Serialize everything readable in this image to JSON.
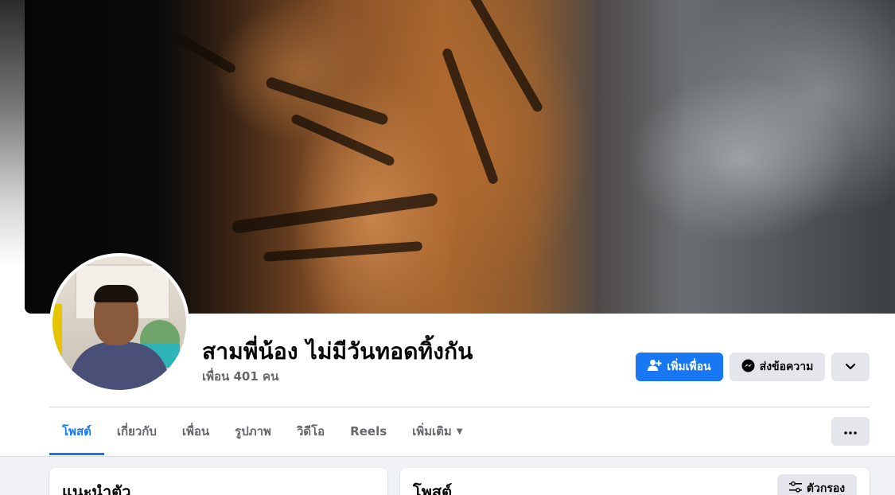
{
  "profile": {
    "name": "สามพี่น้อง ไม่มีวันทอดทิ้งกัน",
    "friends_count": "เพื่อน 401 คน"
  },
  "actions": {
    "add_friend": "เพิ่มเพื่อน",
    "message": "ส่งข้อความ"
  },
  "tabs": [
    {
      "label": "โพสต์",
      "active": true
    },
    {
      "label": "เกี่ยวกับ",
      "active": false
    },
    {
      "label": "เพื่อน",
      "active": false
    },
    {
      "label": "รูปภาพ",
      "active": false
    },
    {
      "label": "วิดีโอ",
      "active": false
    },
    {
      "label": "Reels",
      "active": false
    },
    {
      "label": "เพิ่มเติม",
      "active": false
    }
  ],
  "intro_card": {
    "title": "แนะนำตัว"
  },
  "posts_card": {
    "title": "โพสต์",
    "filter_label": "ตัวกรอง"
  },
  "colors": {
    "accent": "#1877f2",
    "secondary_button": "#e4e6eb",
    "muted_text": "#65676b"
  },
  "icons": [
    "add-friend-icon",
    "messenger-icon",
    "chevron-down-icon",
    "more-dots-icon",
    "filter-icon",
    "caret-down-icon"
  ]
}
